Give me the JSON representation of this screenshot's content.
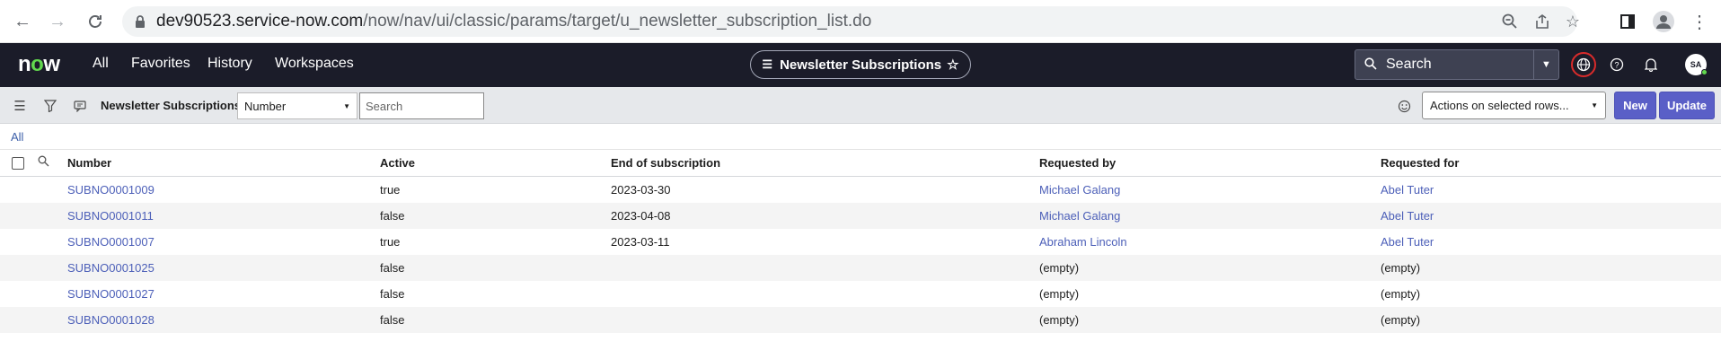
{
  "browser": {
    "url_host": "dev90523.service-now.com",
    "url_path": "/now/nav/ui/classic/params/target/u_newsletter_subscription_list.do"
  },
  "header": {
    "logo": "now",
    "nav": [
      "All",
      "Favorites",
      "History",
      "Workspaces"
    ],
    "context_title": "Newsletter Subscriptions",
    "search_placeholder": "Search",
    "avatar_initials": "SA"
  },
  "toolbar": {
    "list_title": "Newsletter Subscriptions",
    "field_select_value": "Number",
    "search_placeholder": "Search",
    "actions_select_value": "Actions on selected rows...",
    "new_label": "New",
    "update_label": "Update"
  },
  "breadcrumb": "All",
  "table": {
    "columns": [
      "Number",
      "Active",
      "End of subscription",
      "Requested by",
      "Requested for"
    ],
    "rows": [
      {
        "number": "SUBNO0001009",
        "active": "true",
        "end": "2023-03-30",
        "requested_by": "Michael Galang",
        "requested_for": "Abel Tuter"
      },
      {
        "number": "SUBNO0001011",
        "active": "false",
        "end": "2023-04-08",
        "requested_by": "Michael Galang",
        "requested_for": "Abel Tuter"
      },
      {
        "number": "SUBNO0001007",
        "active": "true",
        "end": "2023-03-11",
        "requested_by": "Abraham Lincoln",
        "requested_for": "Abel Tuter"
      },
      {
        "number": "SUBNO0001025",
        "active": "false",
        "end": "",
        "requested_by": "(empty)",
        "requested_for": "(empty)"
      },
      {
        "number": "SUBNO0001027",
        "active": "false",
        "end": "",
        "requested_by": "(empty)",
        "requested_for": "(empty)"
      },
      {
        "number": "SUBNO0001028",
        "active": "false",
        "end": "",
        "requested_by": "(empty)",
        "requested_for": "(empty)"
      }
    ]
  },
  "colors": {
    "header_bg": "#1b1c29",
    "accent": "#5a5fc7",
    "link": "#4c5fb8",
    "logo_green": "#62d84e"
  }
}
